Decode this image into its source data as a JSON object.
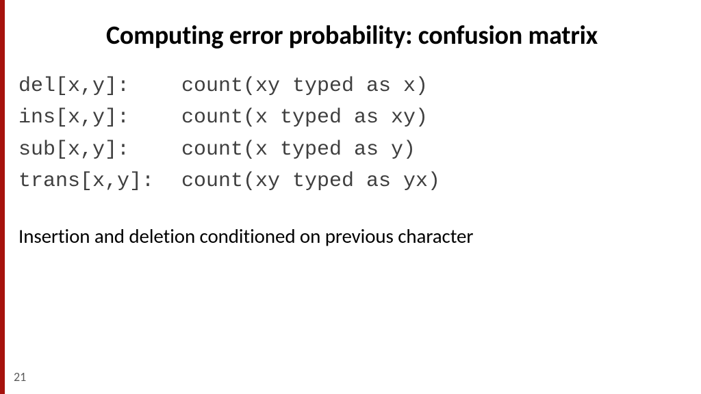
{
  "title": "Computing error probability: confusion matrix",
  "definitions": [
    {
      "label": "del[x,y]:",
      "desc": "count(xy typed as x)"
    },
    {
      "label": "ins[x,y]:",
      "desc": "count(x typed as xy)"
    },
    {
      "label": "sub[x,y]:",
      "desc": "count(x typed as y)"
    },
    {
      "label": "trans[x,y]:",
      "desc": "count(xy typed as yx)"
    }
  ],
  "note": "Insertion and deletion conditioned on previous character",
  "page_number": "21"
}
